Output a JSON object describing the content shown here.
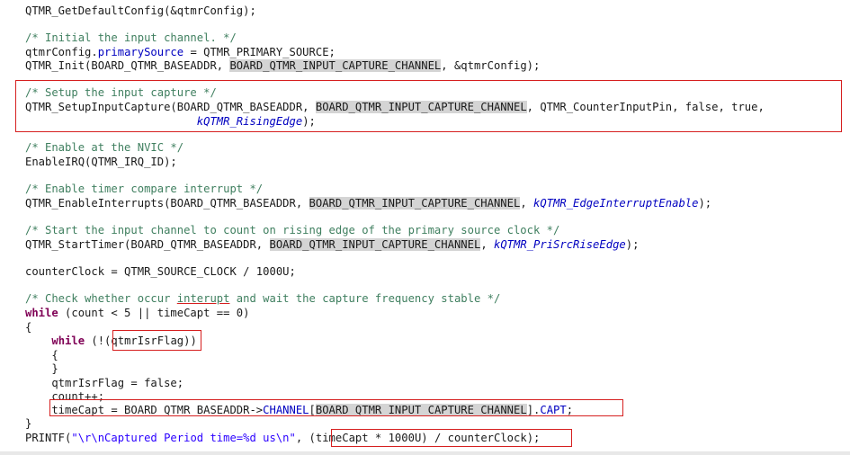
{
  "code": {
    "l1": {
      "a": "QTMR_GetDefaultConfig(&qtmrConfig);"
    },
    "l2": {
      "a": "/* Initial the input channel. */"
    },
    "l3": {
      "a": "qtmrConfig.",
      "b": "primarySource",
      "c": " = QTMR_PRIMARY_SOURCE;"
    },
    "l4": {
      "a": "QTMR_Init(BOARD_QTMR_BASEADDR, ",
      "b": "BOARD_QTMR_INPUT_CAPTURE_CHANNEL",
      "c": ", &qtmrConfig);"
    },
    "l5": {
      "a": "/* Setup the input capture */"
    },
    "l6": {
      "a": "QTMR_SetupInputCapture(BOARD_QTMR_BASEADDR, ",
      "b": "BOARD_QTMR_INPUT_CAPTURE_CHANNEL",
      "c": ", QTMR_CounterInputPin, false, true,"
    },
    "l7": {
      "indent": "                          ",
      "a": "kQTMR_RisingEdge",
      "b": ");"
    },
    "l8": {
      "a": "/* Enable at the NVIC */"
    },
    "l9": {
      "a": "EnableIRQ(QTMR_IRQ_ID);"
    },
    "l10": {
      "a": "/* Enable timer compare interrupt */"
    },
    "l11": {
      "a": "QTMR_EnableInterrupts(BOARD_QTMR_BASEADDR, ",
      "b": "BOARD_QTMR_INPUT_CAPTURE_CHANNEL",
      "c": ", ",
      "d": "kQTMR_EdgeInterruptEnable",
      "e": ");"
    },
    "l12": {
      "a": "/* Start the input channel to count on rising edge of the primary source clock */"
    },
    "l13": {
      "a": "QTMR_StartTimer(BOARD_QTMR_BASEADDR, ",
      "b": "BOARD_QTMR_INPUT_CAPTURE_CHANNEL",
      "c": ", ",
      "d": "kQTMR_PriSrcRiseEdge",
      "e": ");"
    },
    "l14": {
      "a": "counterClock = QTMR_SOURCE_CLOCK / 1000U;"
    },
    "l15": {
      "a": "/* Check whether occur ",
      "b": "interupt",
      "c": " and wait the capture frequency stable */"
    },
    "l16": {
      "kw": "while",
      "a": " (count < 5 || timeCapt == 0)"
    },
    "l17": {
      "a": "{"
    },
    "l18": {
      "indent": "    ",
      "kw": "while",
      "a": " (!(",
      "b": "qtmrIsrFlag",
      "c": "))"
    },
    "l19": {
      "a": "    {"
    },
    "l20": {
      "a": "    }"
    },
    "l21": {
      "a": "    qtmrIsrFlag = false;"
    },
    "l22": {
      "a": "    count++;"
    },
    "l23": {
      "a": "    timeCapt = BOARD_QTMR_BASEADDR->",
      "b": "CHANNEL",
      "c": "[",
      "d": "BOARD_QTMR_INPUT_CAPTURE_CHANNEL",
      "e": "].",
      "f": "CAPT",
      "g": ";"
    },
    "l24": {
      "a": "}"
    },
    "l25": {
      "a": "PRINTF(",
      "b": "\"\\r\\nCaptured Period time=%d us\\n\"",
      "c": ", ",
      "d": "(timeCapt * 1000U) / counterClock",
      "e": ");"
    }
  },
  "colors": {
    "comment": "#3f7f5f",
    "keyword": "#7f0055",
    "field": "#0000c0",
    "string": "#2a00ff",
    "highlight": "#d4d4d4",
    "annotation_box": "#d61f1f"
  }
}
